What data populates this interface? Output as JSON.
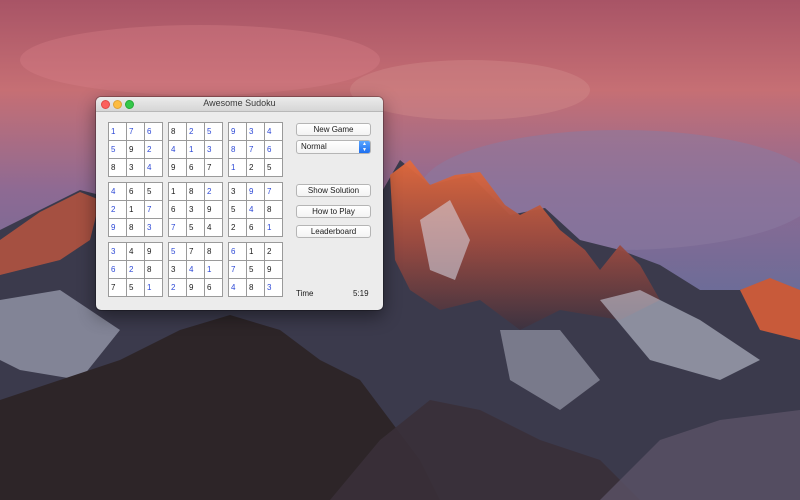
{
  "window": {
    "title": "Awesome Sudoku"
  },
  "controls": {
    "new_game": "New Game",
    "difficulty": {
      "selected": "Normal"
    },
    "show_solution": "Show Solution",
    "how_to_play": "How to Play",
    "leaderboard": "Leaderboard"
  },
  "timer": {
    "label": "Time",
    "value": "5:19"
  },
  "board": {
    "boxes": [
      {
        "cells": [
          {
            "v": "1",
            "u": true
          },
          {
            "v": "7",
            "u": true
          },
          {
            "v": "6",
            "u": true
          },
          {
            "v": "5",
            "u": true
          },
          {
            "v": "9",
            "u": false
          },
          {
            "v": "2",
            "u": true
          },
          {
            "v": "8",
            "u": false
          },
          {
            "v": "3",
            "u": false
          },
          {
            "v": "4",
            "u": true
          }
        ]
      },
      {
        "cells": [
          {
            "v": "8",
            "u": false
          },
          {
            "v": "2",
            "u": true
          },
          {
            "v": "5",
            "u": true
          },
          {
            "v": "4",
            "u": true
          },
          {
            "v": "1",
            "u": true
          },
          {
            "v": "3",
            "u": true
          },
          {
            "v": "9",
            "u": false
          },
          {
            "v": "6",
            "u": false
          },
          {
            "v": "7",
            "u": false
          }
        ]
      },
      {
        "cells": [
          {
            "v": "9",
            "u": true
          },
          {
            "v": "3",
            "u": true
          },
          {
            "v": "4",
            "u": true
          },
          {
            "v": "8",
            "u": true
          },
          {
            "v": "7",
            "u": true
          },
          {
            "v": "6",
            "u": true
          },
          {
            "v": "1",
            "u": true
          },
          {
            "v": "2",
            "u": false
          },
          {
            "v": "5",
            "u": false
          }
        ]
      },
      {
        "cells": [
          {
            "v": "4",
            "u": true
          },
          {
            "v": "6",
            "u": false
          },
          {
            "v": "5",
            "u": false
          },
          {
            "v": "2",
            "u": true
          },
          {
            "v": "1",
            "u": false
          },
          {
            "v": "7",
            "u": true
          },
          {
            "v": "9",
            "u": true
          },
          {
            "v": "8",
            "u": false
          },
          {
            "v": "3",
            "u": true
          }
        ]
      },
      {
        "cells": [
          {
            "v": "1",
            "u": false
          },
          {
            "v": "8",
            "u": false
          },
          {
            "v": "2",
            "u": true
          },
          {
            "v": "6",
            "u": false
          },
          {
            "v": "3",
            "u": false
          },
          {
            "v": "9",
            "u": false
          },
          {
            "v": "7",
            "u": true
          },
          {
            "v": "5",
            "u": false
          },
          {
            "v": "4",
            "u": false
          }
        ]
      },
      {
        "cells": [
          {
            "v": "3",
            "u": false
          },
          {
            "v": "9",
            "u": true
          },
          {
            "v": "7",
            "u": true
          },
          {
            "v": "5",
            "u": false
          },
          {
            "v": "4",
            "u": true
          },
          {
            "v": "8",
            "u": false
          },
          {
            "v": "2",
            "u": false
          },
          {
            "v": "6",
            "u": false
          },
          {
            "v": "1",
            "u": true
          }
        ]
      },
      {
        "cells": [
          {
            "v": "3",
            "u": true
          },
          {
            "v": "4",
            "u": false
          },
          {
            "v": "9",
            "u": false
          },
          {
            "v": "6",
            "u": true
          },
          {
            "v": "2",
            "u": true
          },
          {
            "v": "8",
            "u": false
          },
          {
            "v": "7",
            "u": false
          },
          {
            "v": "5",
            "u": false
          },
          {
            "v": "1",
            "u": true
          }
        ]
      },
      {
        "cells": [
          {
            "v": "5",
            "u": true
          },
          {
            "v": "7",
            "u": false
          },
          {
            "v": "8",
            "u": false
          },
          {
            "v": "3",
            "u": false
          },
          {
            "v": "4",
            "u": true
          },
          {
            "v": "1",
            "u": true
          },
          {
            "v": "2",
            "u": true
          },
          {
            "v": "9",
            "u": false
          },
          {
            "v": "6",
            "u": false
          }
        ]
      },
      {
        "cells": [
          {
            "v": "6",
            "u": true
          },
          {
            "v": "1",
            "u": false
          },
          {
            "v": "2",
            "u": false
          },
          {
            "v": "7",
            "u": true
          },
          {
            "v": "5",
            "u": false
          },
          {
            "v": "9",
            "u": false
          },
          {
            "v": "4",
            "u": true
          },
          {
            "v": "8",
            "u": false
          },
          {
            "v": "3",
            "u": true
          }
        ]
      }
    ]
  },
  "colors": {
    "given_digit": "#1a1a1a",
    "entered_digit": "#2c48d6"
  },
  "icons": {
    "close": "close-traffic-light-icon",
    "minimize": "minimize-traffic-light-icon",
    "zoom": "zoom-traffic-light-icon",
    "select_arrows": "chevron-up-down-icon"
  }
}
